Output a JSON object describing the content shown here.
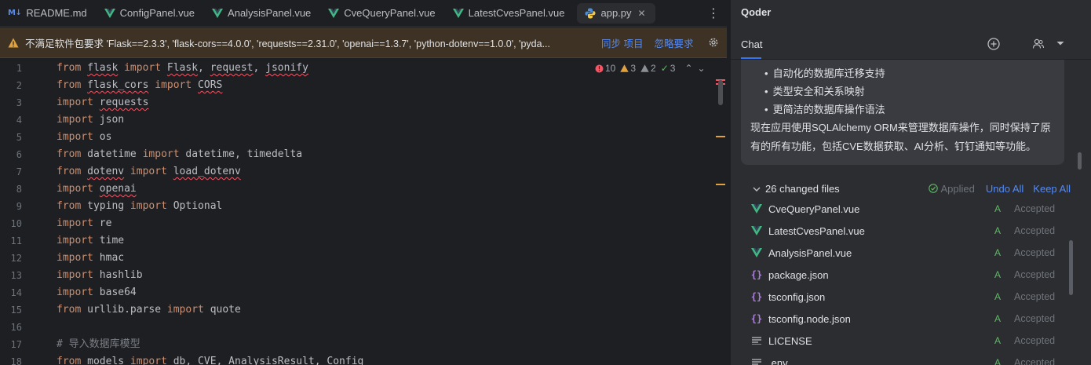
{
  "tabs": [
    {
      "label": "README.md",
      "icon": "markdown-icon",
      "icon_text": "M↓"
    },
    {
      "label": "ConfigPanel.vue",
      "icon": "vue-icon"
    },
    {
      "label": "AnalysisPanel.vue",
      "icon": "vue-icon"
    },
    {
      "label": "CveQueryPanel.vue",
      "icon": "vue-icon"
    },
    {
      "label": "LatestCvesPanel.vue",
      "icon": "vue-icon"
    },
    {
      "label": "app.py",
      "icon": "python-icon",
      "active": true
    }
  ],
  "warning": {
    "message": "不满足软件包要求 'Flask==2.3.3', 'flask-cors==4.0.0', 'requests==2.31.0', 'openai==1.3.7', 'python-dotenv==1.0.0', 'pyda...",
    "sync_label": "同步 项目",
    "ignore_label": "忽略要求"
  },
  "inspections": {
    "errors": "10",
    "warnings": "3",
    "weak_warnings": "2",
    "ok": "3"
  },
  "editor": {
    "line_numbers": [
      "1",
      "2",
      "3",
      "4",
      "5",
      "6",
      "7",
      "8",
      "9",
      "10",
      "11",
      "12",
      "13",
      "14",
      "15",
      "16",
      "17",
      "18"
    ]
  },
  "panel": {
    "title": "Qoder",
    "tab_chat": "Chat",
    "bullets": [
      "自动化的数据库迁移支持",
      "类型安全和关系映射",
      "更简洁的数据库操作语法"
    ],
    "paragraph": "现在应用使用SQLAlchemy ORM来管理数据库操作，同时保持了原有的所有功能，包括CVE数据获取、AI分析、钉钉通知等功能。",
    "changes": {
      "title": "26 changed files",
      "applied": "Applied",
      "undo_all": "Undo All",
      "keep_all": "Keep All",
      "files": [
        {
          "name": "CveQueryPanel.vue",
          "icon": "vue-icon",
          "status": "A",
          "state": "Accepted"
        },
        {
          "name": "LatestCvesPanel.vue",
          "icon": "vue-icon",
          "status": "A",
          "state": "Accepted"
        },
        {
          "name": "AnalysisPanel.vue",
          "icon": "vue-icon",
          "status": "A",
          "state": "Accepted"
        },
        {
          "name": "package.json",
          "icon": "json-icon",
          "status": "A",
          "state": "Accepted"
        },
        {
          "name": "tsconfig.json",
          "icon": "json-icon",
          "status": "A",
          "state": "Accepted"
        },
        {
          "name": "tsconfig.node.json",
          "icon": "json-icon",
          "status": "A",
          "state": "Accepted"
        },
        {
          "name": "LICENSE",
          "icon": "text-file-icon",
          "status": "A",
          "state": "Accepted"
        },
        {
          "name": ".env",
          "icon": "text-file-icon",
          "status": "A",
          "state": "Accepted"
        }
      ]
    }
  },
  "colors": {
    "accent": "#3574f0",
    "vue_green": "#41b883",
    "added_green": "#5fb865",
    "error_red": "#f75464",
    "warn_yellow": "#e0a13f"
  }
}
